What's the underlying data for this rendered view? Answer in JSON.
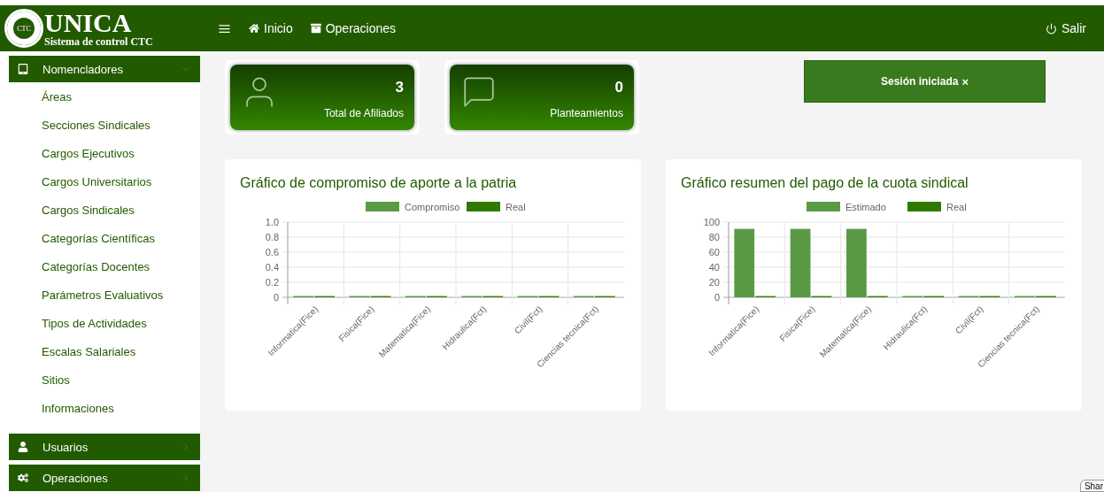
{
  "header": {
    "logo_badge": "CTC",
    "logo_title": "UNICA",
    "logo_subtitle": "Sistema de control CTC",
    "nav": [
      {
        "label": "Inicio",
        "kind": "home"
      },
      {
        "label": "Operaciones",
        "kind": "archive"
      }
    ],
    "logout": "Salir"
  },
  "sidebar": {
    "sections": [
      {
        "label": "Nomencladores",
        "kind": "tablet",
        "expanded": true,
        "items": [
          "Áreas",
          "Secciones Sindicales",
          "Cargos Ejecutivos",
          "Cargos Universitarios",
          "Cargos Sindicales",
          "Categorías Científicas",
          "Categorías Docentes",
          "Parámetros Evaluativos",
          "Tipos de Actividades",
          "Escalas Salariales",
          "Sitios",
          "Informaciones"
        ]
      },
      {
        "label": "Usuarios",
        "kind": "user",
        "expanded": false
      },
      {
        "label": "Operaciones",
        "kind": "gears",
        "expanded": false
      }
    ]
  },
  "stats": [
    {
      "value": "3",
      "label": "Total de Afiliados",
      "kind": "user"
    },
    {
      "value": "0",
      "label": "Planteamientos",
      "kind": "chat"
    }
  ],
  "alert": {
    "text": "Sesión iniciada",
    "close": "×"
  },
  "charts": [
    {
      "title": "Gráfico de compromiso de aporte a la patria",
      "chart_data": {
        "type": "bar",
        "grid": true,
        "legend": "top",
        "categories": [
          "Informatica(Fice)",
          "Fisica(Fice)",
          "Matematica(Fice)",
          "Hidraulica(Fct)",
          "Civil(Fct)",
          "Ciencias tecnica(Fct)"
        ],
        "series": [
          {
            "name": "Compromiso",
            "color": "#5b9a45",
            "values": [
              0,
              0,
              0,
              0,
              0,
              0
            ]
          },
          {
            "name": "Real",
            "color": "#2e7a00",
            "values": [
              0,
              0,
              0,
              0,
              0,
              0
            ]
          }
        ],
        "ylim": [
          0,
          1
        ],
        "yticks": [
          {
            "value": 0,
            "label": "0"
          },
          {
            "value": 0.2,
            "label": "0.2"
          },
          {
            "value": 0.4,
            "label": "0.4"
          },
          {
            "value": 0.6,
            "label": "0.6"
          },
          {
            "value": 0.8,
            "label": "0.8"
          },
          {
            "value": 1,
            "label": "1.0"
          }
        ]
      }
    },
    {
      "title": "Gráfico resumen del pago de la cuota sindical",
      "chart_data": {
        "type": "bar",
        "grid": true,
        "legend": "top",
        "categories": [
          "Informatica(Fice)",
          "Fisica(Fice)",
          "Matematica(Fice)",
          "Hidraulica(Fct)",
          "Civil(Fct)",
          "Ciencias tecnica(Fct)"
        ],
        "series": [
          {
            "name": "Estimado",
            "color": "#5b9a45",
            "values": [
              91,
              91,
              91,
              0,
              0,
              0
            ]
          },
          {
            "name": "Real",
            "color": "#2e7a00",
            "values": [
              0,
              0,
              0,
              0,
              0,
              0
            ]
          }
        ],
        "ylim": [
          0,
          100
        ],
        "yticks": [
          0,
          20,
          40,
          60,
          80,
          100
        ]
      }
    }
  ],
  "share_button": "Shar"
}
